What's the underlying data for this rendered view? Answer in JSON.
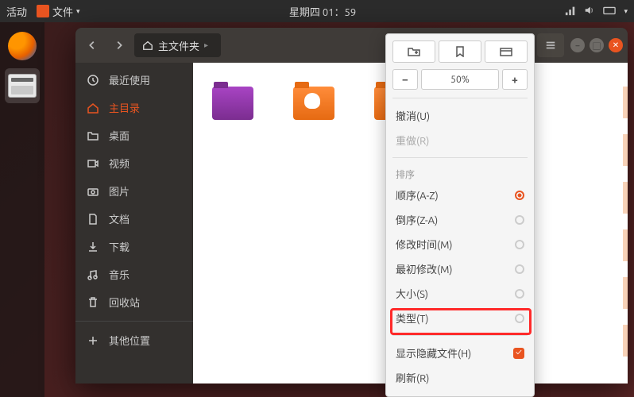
{
  "topbar": {
    "activities": "活动",
    "app_name": "文件",
    "clock": "星期四 01：59"
  },
  "window": {
    "location_label": "主文件夹"
  },
  "sidebar": {
    "items": [
      {
        "key": "recent",
        "label": "最近使用"
      },
      {
        "key": "home",
        "label": "主目录"
      },
      {
        "key": "desktop",
        "label": "桌面"
      },
      {
        "key": "videos",
        "label": "视频"
      },
      {
        "key": "pictures",
        "label": "图片"
      },
      {
        "key": "documents",
        "label": "文档"
      },
      {
        "key": "downloads",
        "label": "下载"
      },
      {
        "key": "music",
        "label": "音乐"
      },
      {
        "key": "trash",
        "label": "回收站"
      },
      {
        "key": "other",
        "label": "其他位置"
      }
    ]
  },
  "popover": {
    "zoom_value": "50%",
    "undo": "撤消(U)",
    "redo": "重做(R)",
    "sort_header": "排序",
    "sort_options": [
      {
        "label": "顺序(A-Z)",
        "selected": true
      },
      {
        "label": "倒序(Z-A)",
        "selected": false
      },
      {
        "label": "修改时间(M)",
        "selected": false
      },
      {
        "label": "最初修改(M)",
        "selected": false
      },
      {
        "label": "大小(S)",
        "selected": false
      },
      {
        "label": "类型(T)",
        "selected": false
      }
    ],
    "show_hidden": "显示隐藏文件(H)",
    "show_hidden_checked": true,
    "refresh": "刷新(R)"
  }
}
